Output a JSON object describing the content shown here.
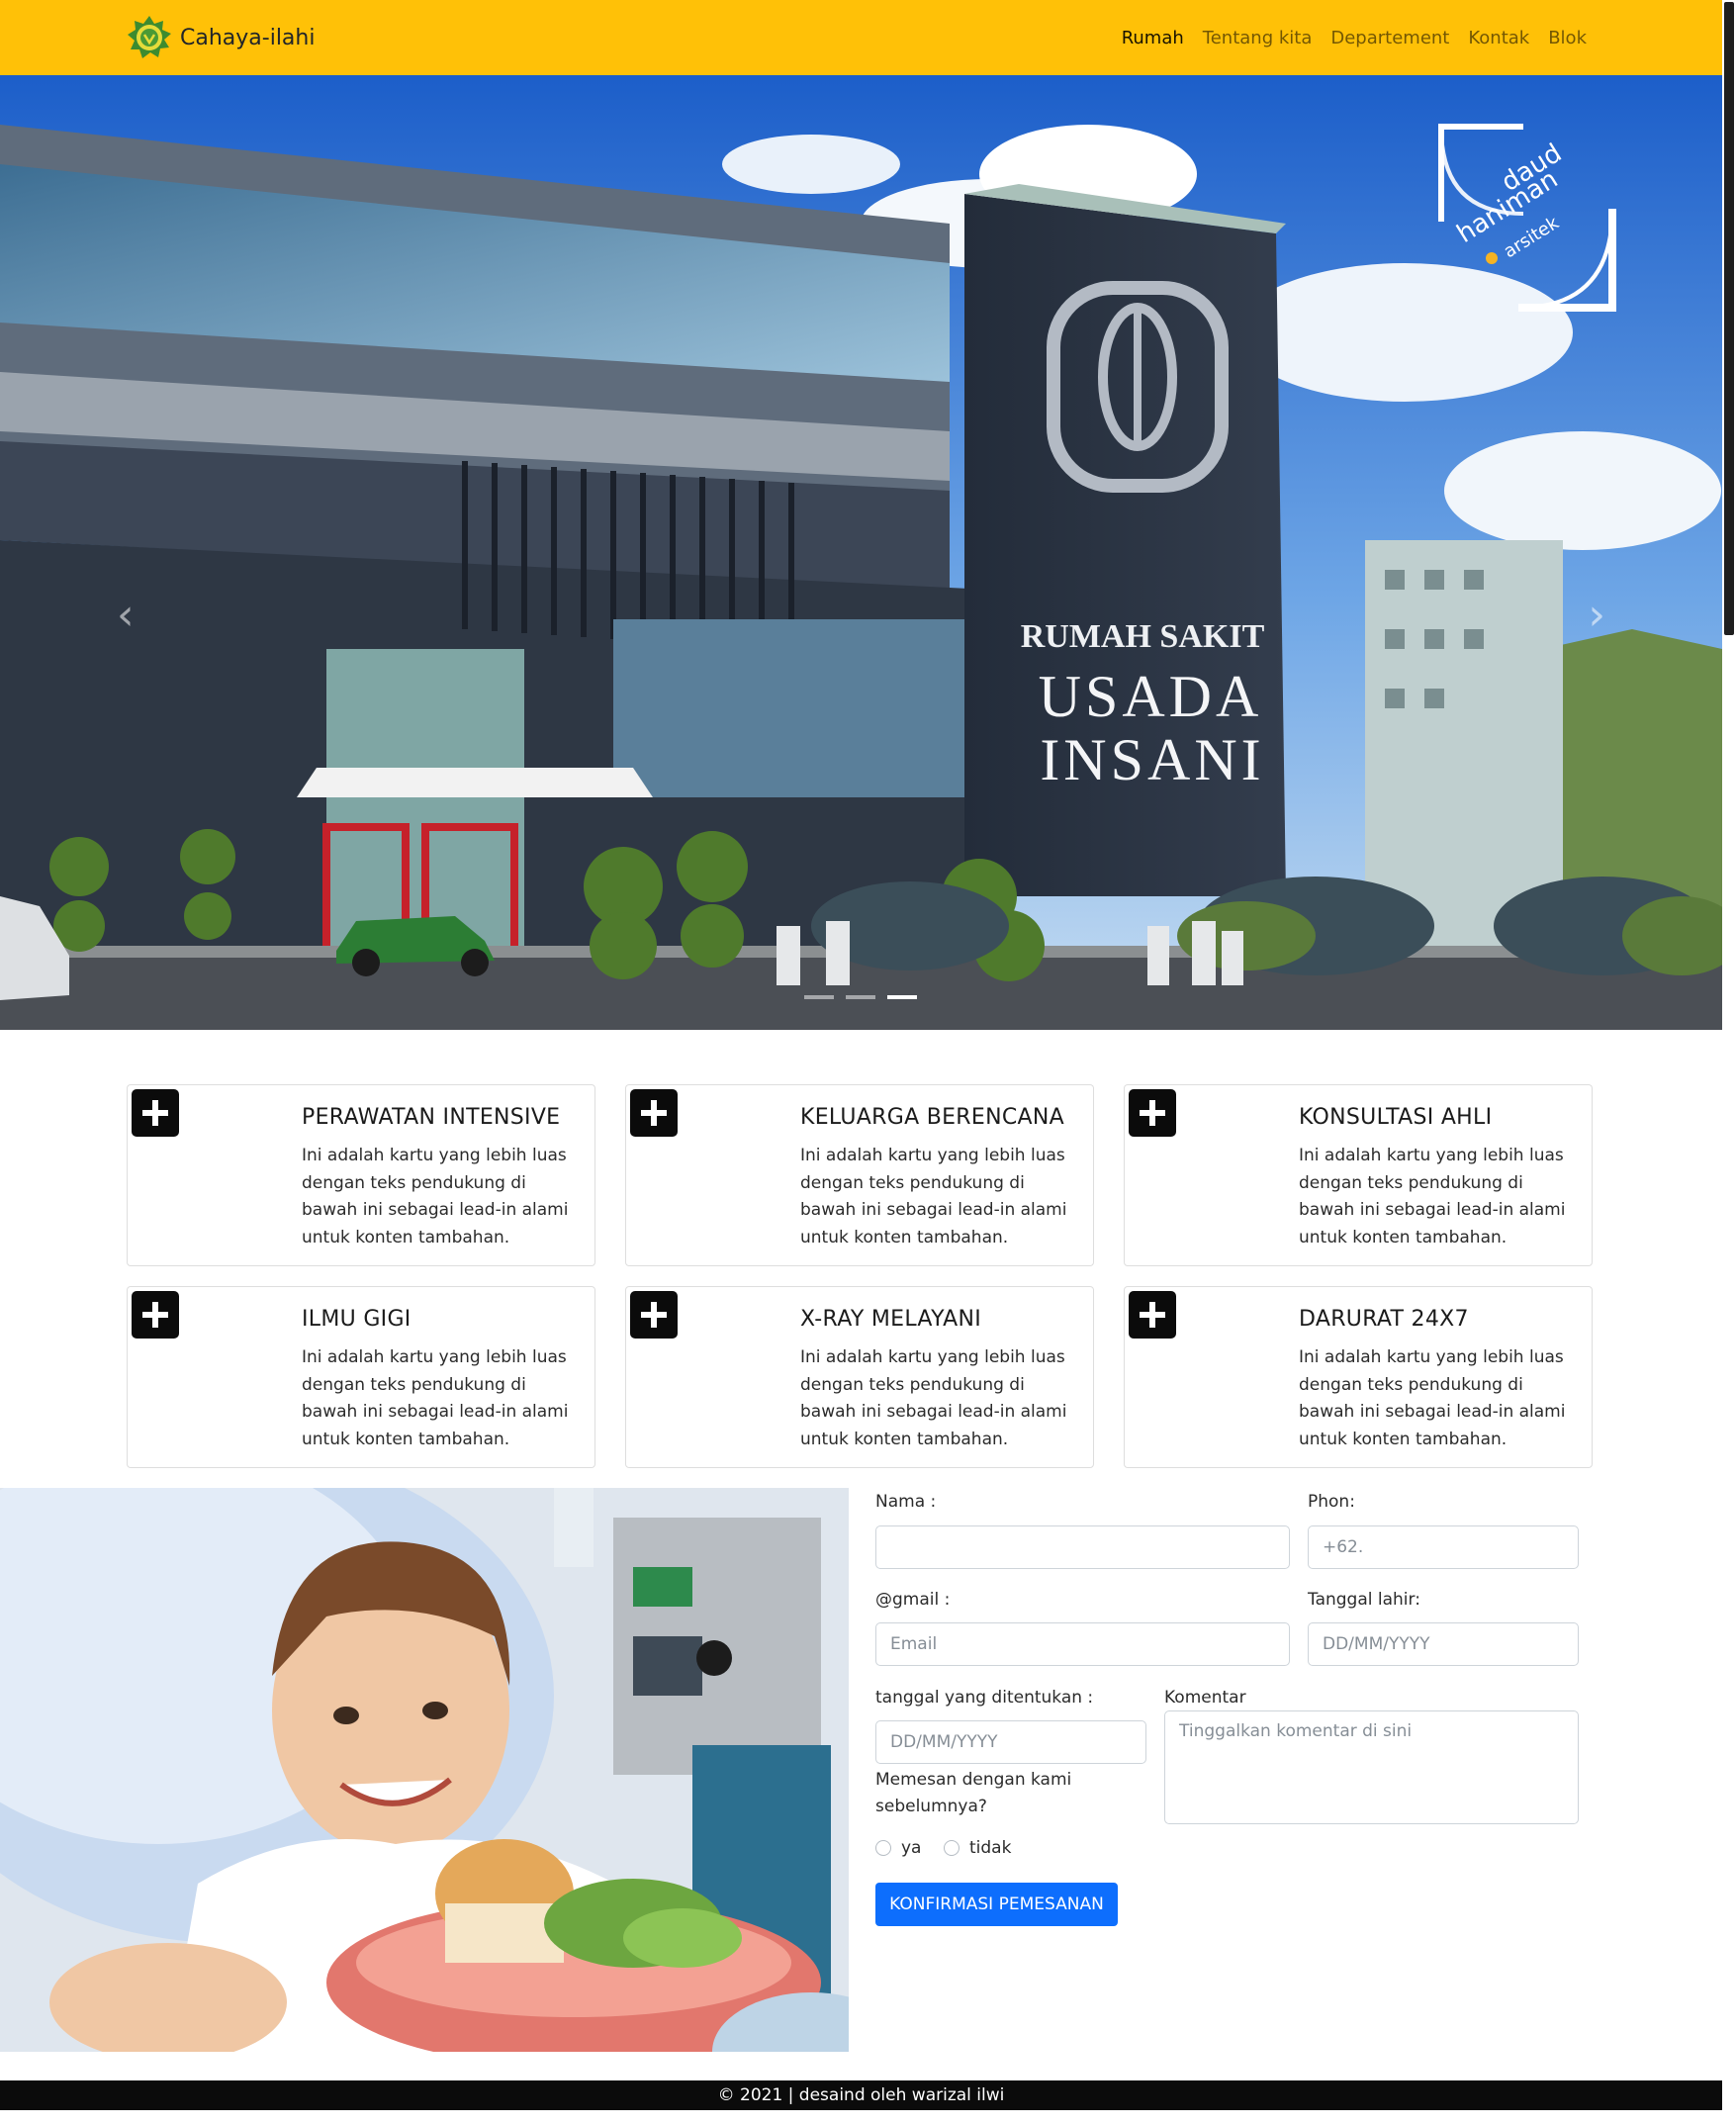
{
  "colors": {
    "navbar": "#ffc107",
    "primary_button": "#0d6efd",
    "footer": "#0b0b0b",
    "card_icon": "#0b0b0b"
  },
  "brand": {
    "name": "Cahaya-ilahi",
    "icon": "gear-emblem-icon"
  },
  "nav": {
    "items": [
      {
        "label": "Rumah",
        "active": true
      },
      {
        "label": "Tentang kita",
        "active": false
      },
      {
        "label": "Departement",
        "active": false
      },
      {
        "label": "Kontak",
        "active": false
      },
      {
        "label": "Blok",
        "active": false
      }
    ]
  },
  "hero": {
    "sign_line1": "RUMAH SAKIT",
    "sign_line2": "USADA",
    "sign_line3": "INSANI",
    "watermark_line1": "daud",
    "watermark_line2": "haniman",
    "watermark_line3": "arsitek",
    "prev_icon": "‹",
    "next_icon": "›",
    "slide_count": 3,
    "active_slide": 3
  },
  "services": [
    {
      "title": "PERAWATAN INTENSIVE",
      "text": "Ini adalah kartu yang lebih luas dengan teks pendukung di bawah ini sebagai lead-in alami untuk konten tambahan.",
      "icon": "plus-icon"
    },
    {
      "title": "KELUARGA BERENCANA",
      "text": "Ini adalah kartu yang lebih luas dengan teks pendukung di bawah ini sebagai lead-in alami untuk konten tambahan.",
      "icon": "plus-icon"
    },
    {
      "title": "KONSULTASI AHLI",
      "text": "Ini adalah kartu yang lebih luas dengan teks pendukung di bawah ini sebagai lead-in alami untuk konten tambahan.",
      "icon": "plus-icon"
    },
    {
      "title": "ILMU GIGI",
      "text": "Ini adalah kartu yang lebih luas dengan teks pendukung di bawah ini sebagai lead-in alami untuk konten tambahan.",
      "icon": "plus-icon"
    },
    {
      "title": "X-RAY MELAYANI",
      "text": "Ini adalah kartu yang lebih luas dengan teks pendukung di bawah ini sebagai lead-in alami untuk konten tambahan.",
      "icon": "plus-icon"
    },
    {
      "title": "DARURAT 24X7",
      "text": "Ini adalah kartu yang lebih luas dengan teks pendukung di bawah ini sebagai lead-in alami untuk konten tambahan.",
      "icon": "plus-icon"
    }
  ],
  "form": {
    "nama_label": "Nama :",
    "nama_value": "",
    "phone_label": "Phon:",
    "phone_placeholder": "+62.",
    "email_label": "@gmail :",
    "email_placeholder": "Email",
    "dob_label": "Tanggal lahir:",
    "dob_placeholder": "DD/MM/YYYY",
    "date_label": "tanggal yang ditentukan :",
    "date_placeholder": "DD/MM/YYYY",
    "comment_label": "Komentar",
    "comment_placeholder": "Tinggalkan komentar di sini",
    "question": "Memesan dengan kami sebelumnya?",
    "option_yes": "ya",
    "option_no": "tidak",
    "submit": "KONFIRMASI PEMESANAN"
  },
  "footer": {
    "text": "© 2021 | desaind oleh warizal ilwi"
  }
}
